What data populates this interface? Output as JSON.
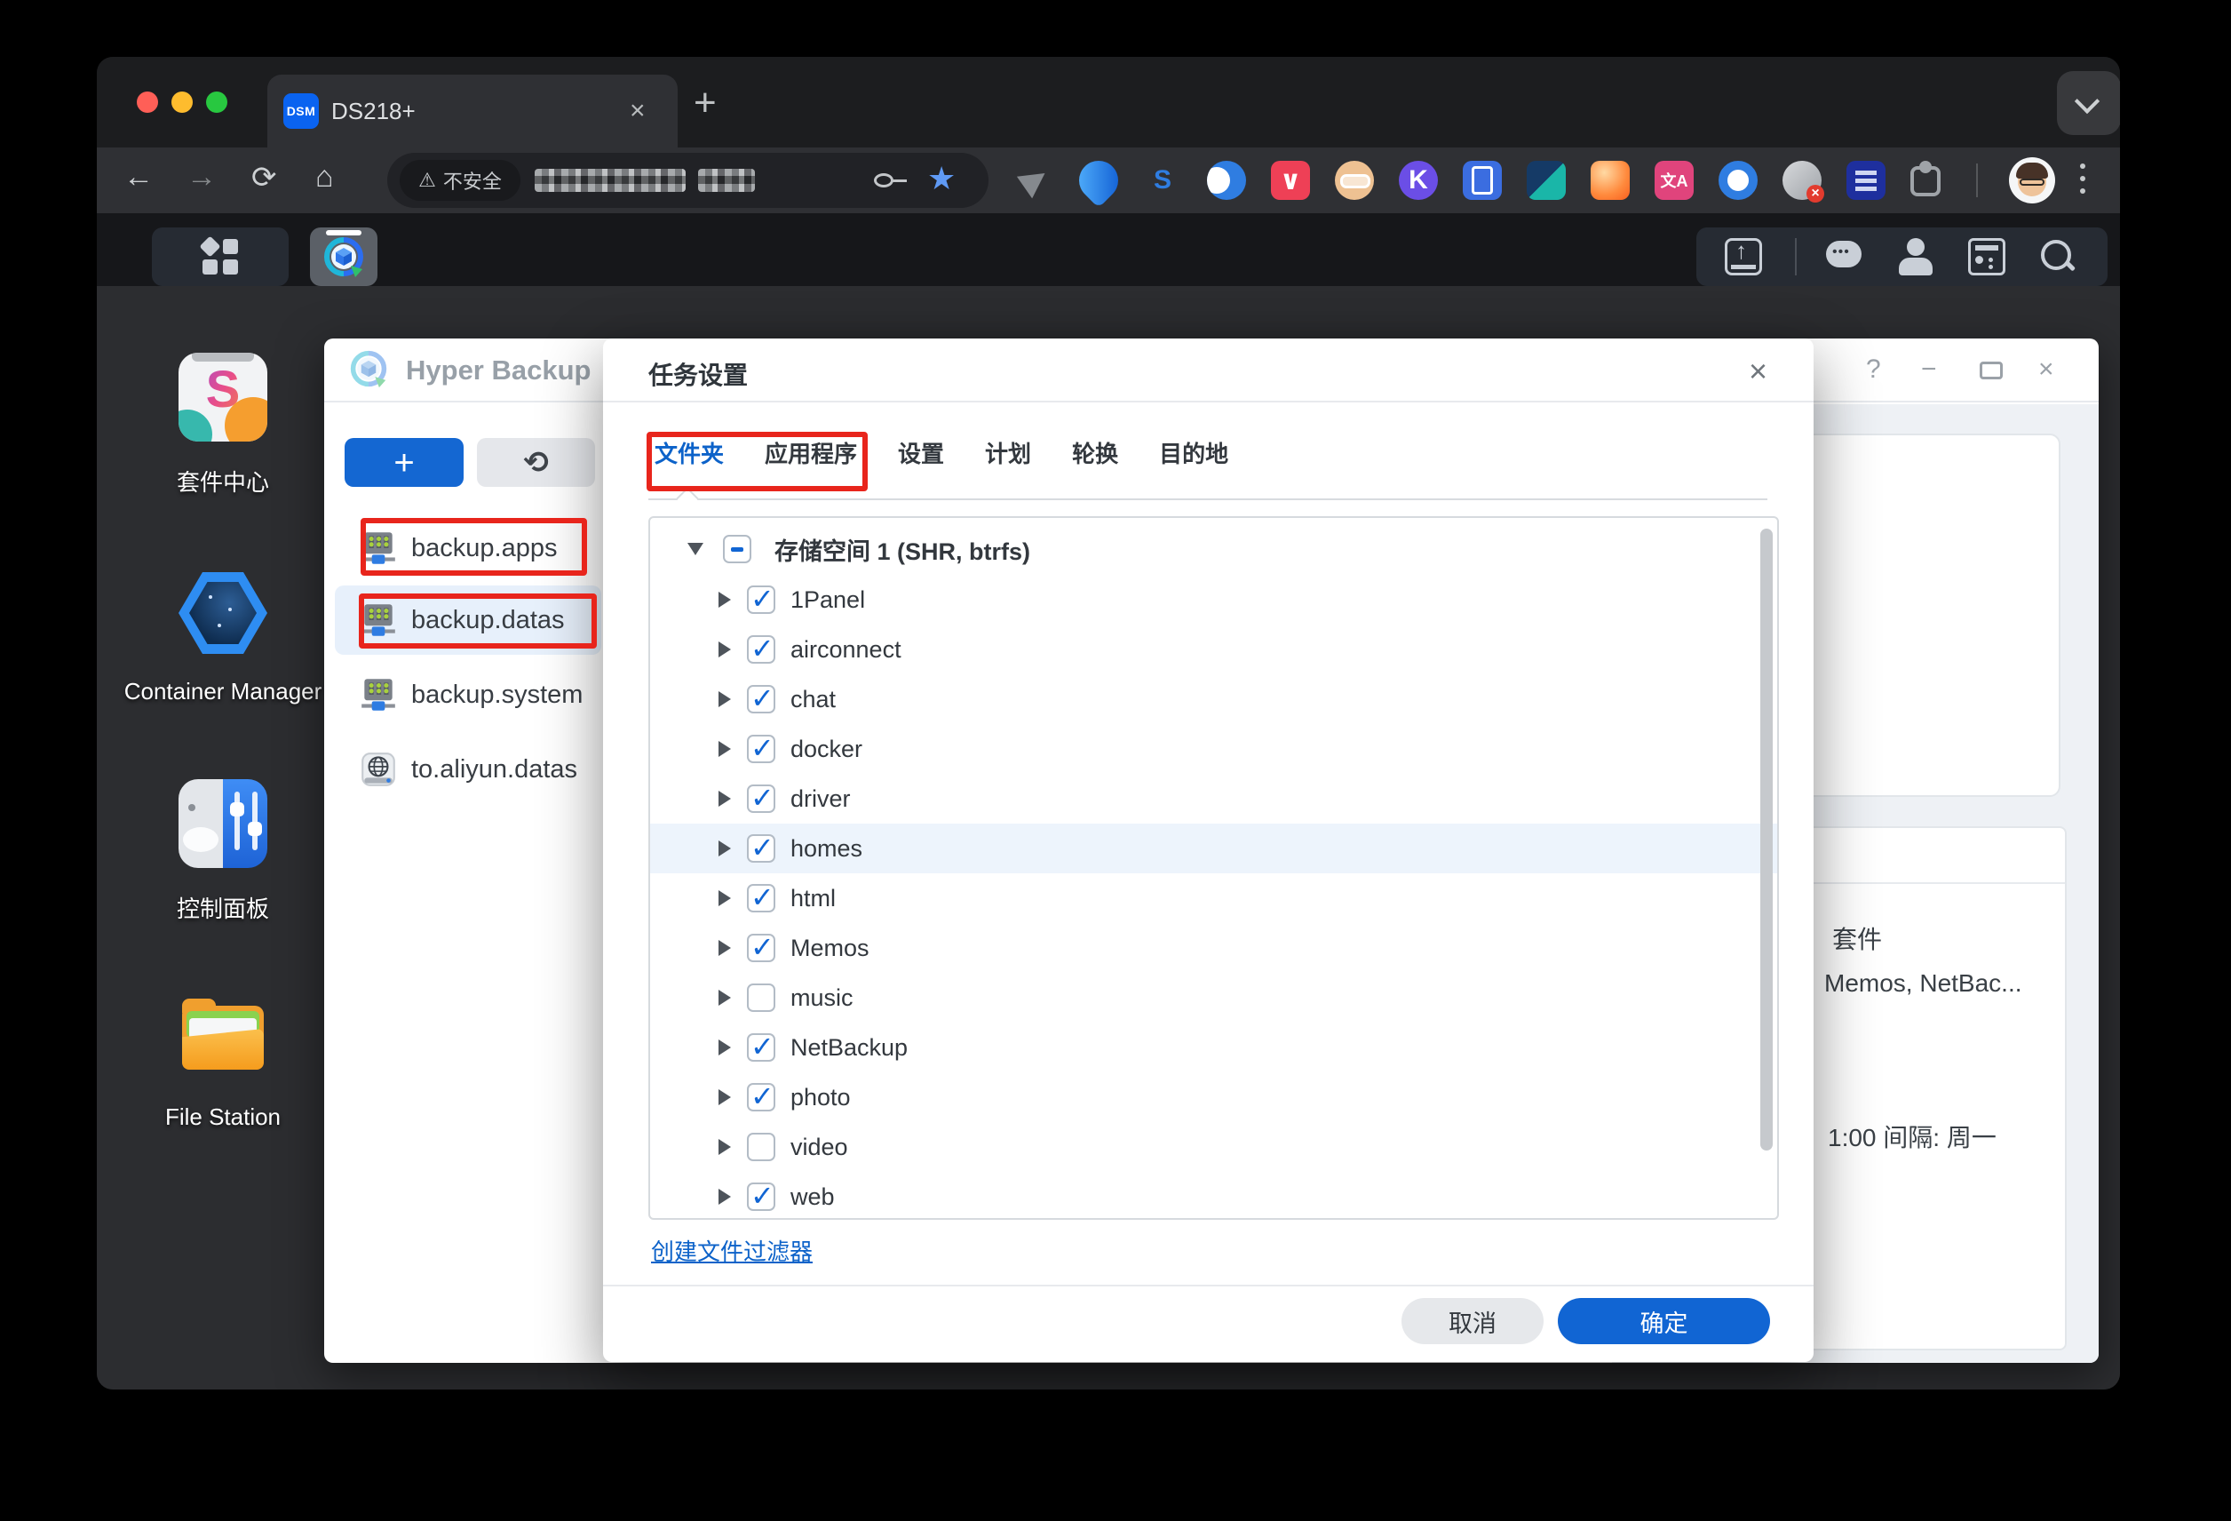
{
  "browser": {
    "tab_title": "DS218+",
    "tab_favicon": "DSM",
    "tab_close": "×",
    "new_tab": "+",
    "nav": {
      "back": "←",
      "forward": "→",
      "reload": "⟳",
      "home": "⌂"
    },
    "security_label": "不安全",
    "warning_glyph": "⚠",
    "bookmark_star": "★",
    "extensions": [
      {
        "name": "send-arrow-icon",
        "shape": "triangle",
        "bg": "",
        "glyph": "",
        "fg": ""
      },
      {
        "name": "map-pin-icon",
        "shape": "drop",
        "bg": "linear-gradient(135deg,#57b6ff,#0b57d0)",
        "glyph": "",
        "fg": ""
      },
      {
        "name": "s-curve-icon",
        "shape": "circle",
        "bg": "",
        "glyph": "S",
        "fg": "#2f7de1"
      },
      {
        "name": "wave-circle-icon",
        "shape": "crescent",
        "bg": "#2f7de1",
        "glyph": "",
        "fg": ""
      },
      {
        "name": "pocket-icon",
        "shape": "rounded",
        "bg": "#ee4056",
        "glyph": "∨",
        "fg": "#ffffff"
      },
      {
        "name": "face-glasses-icon",
        "shape": "face",
        "bg": "#eec192",
        "glyph": "",
        "fg": ""
      },
      {
        "name": "k-circle-icon",
        "shape": "circle",
        "bg": "#6b4ee6",
        "glyph": "K",
        "fg": "#ffffff"
      },
      {
        "name": "phone-lock-icon",
        "shape": "phone",
        "bg": "#3b6de0",
        "glyph": "",
        "fg": ""
      },
      {
        "name": "geometric-icon",
        "shape": "split",
        "bg": "linear-gradient(135deg,#153a66 50%,#1ab6a8 50%)",
        "glyph": "",
        "fg": ""
      },
      {
        "name": "orange-blob-icon",
        "shape": "rounded",
        "bg": "radial-gradient(circle at 35% 30%,#ffd9a3,#ff8a3d 60%,#f95f1e)",
        "glyph": "",
        "fg": ""
      },
      {
        "name": "translate-icon",
        "shape": "rounded",
        "bg": "#e0447c",
        "glyph": "文A",
        "fg": "#ffffff"
      },
      {
        "name": "ring-icon",
        "shape": "ring",
        "bg": "#ffffff",
        "glyph": "",
        "fg": ""
      },
      {
        "name": "error-badge-icon",
        "shape": "errorbadge",
        "bg": "linear-gradient(135deg,#d7d9dc,#9fa3a8)",
        "glyph": "",
        "fg": ""
      },
      {
        "name": "list-rows-icon",
        "shape": "rows",
        "bg": "#1e2f9e",
        "glyph": "",
        "fg": ""
      },
      {
        "name": "extensions-puzzle-icon",
        "shape": "puzzle",
        "bg": "",
        "glyph": "",
        "fg": ""
      }
    ]
  },
  "dsm": {
    "desktop": [
      {
        "label": "套件中心"
      },
      {
        "label": "Container Manager"
      },
      {
        "label": "控制面板"
      },
      {
        "label": "File Station"
      }
    ]
  },
  "hyper_backup": {
    "title": "Hyper Backup",
    "controls": {
      "help": "?",
      "minimize": "−",
      "close": "×"
    },
    "create_label": "+",
    "restore_glyph": "⟲",
    "tasks": [
      {
        "name": "backup.apps",
        "icon": "server",
        "selected": false
      },
      {
        "name": "backup.datas",
        "icon": "server",
        "selected": true
      },
      {
        "name": "backup.system",
        "icon": "server",
        "selected": false
      },
      {
        "name": "to.aliyun.datas",
        "icon": "globe",
        "selected": false
      }
    ],
    "right_panel": [
      "套件",
      "Memos, NetBac...",
      "1:00 间隔: 周一"
    ]
  },
  "dialog": {
    "title": "任务设置",
    "close_glyph": "×",
    "tabs": [
      {
        "label": "文件夹",
        "active": true
      },
      {
        "label": "应用程序",
        "active": false
      },
      {
        "label": "设置",
        "active": false
      },
      {
        "label": "计划",
        "active": false
      },
      {
        "label": "轮换",
        "active": false
      },
      {
        "label": "目的地",
        "active": false
      }
    ],
    "tree": {
      "root": {
        "label": "存储空间 1 (SHR, btrfs)",
        "state": "indeterminate"
      },
      "children": [
        {
          "label": "1Panel",
          "checked": true,
          "highlighted": false
        },
        {
          "label": "airconnect",
          "checked": true,
          "highlighted": false
        },
        {
          "label": "chat",
          "checked": true,
          "highlighted": false
        },
        {
          "label": "docker",
          "checked": true,
          "highlighted": false
        },
        {
          "label": "driver",
          "checked": true,
          "highlighted": false
        },
        {
          "label": "homes",
          "checked": true,
          "highlighted": true
        },
        {
          "label": "html",
          "checked": true,
          "highlighted": false
        },
        {
          "label": "Memos",
          "checked": true,
          "highlighted": false
        },
        {
          "label": "music",
          "checked": false,
          "highlighted": false
        },
        {
          "label": "NetBackup",
          "checked": true,
          "highlighted": false
        },
        {
          "label": "photo",
          "checked": true,
          "highlighted": false
        },
        {
          "label": "video",
          "checked": false,
          "highlighted": false
        },
        {
          "label": "web",
          "checked": true,
          "highlighted": false
        }
      ]
    },
    "filter_link": "创建文件过滤器",
    "footer": {
      "cancel": "取消",
      "ok": "确定"
    }
  },
  "colors": {
    "accent_blue": "#1165d3",
    "annotation_red": "#e8251c",
    "selected_row": "#e7f0fb",
    "tab_active_blue": "#0c62c9"
  }
}
